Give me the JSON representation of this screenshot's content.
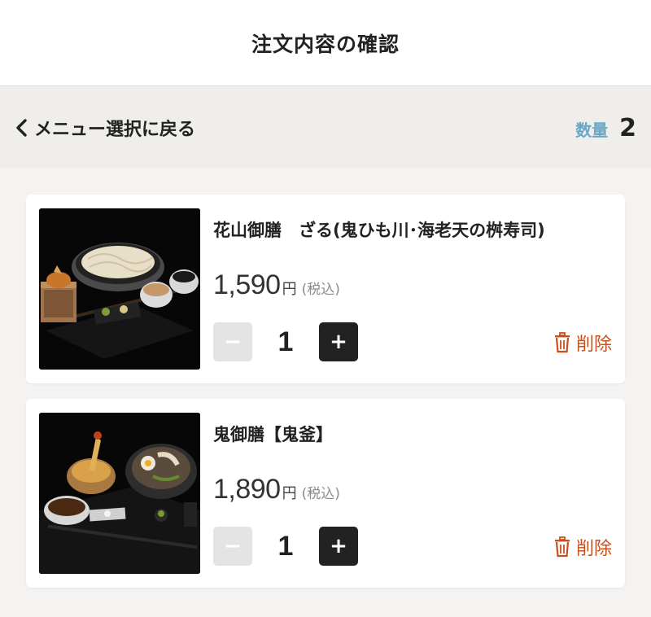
{
  "header": {
    "title": "注文内容の確認"
  },
  "subbar": {
    "back_label": "メニュー選択に戻る",
    "qty_label": "数量",
    "qty_value": "2"
  },
  "items": [
    {
      "name": "花山御膳　ざる(鬼ひも川･海老天の桝寿司)",
      "price": "1,590",
      "unit": "円",
      "tax": "(税込)",
      "quantity": "1",
      "minus": "−",
      "plus": "+",
      "delete_label": "削除",
      "image_icon": "zaru-udon-set-photo"
    },
    {
      "name": "鬼御膳【鬼釜】",
      "price": "1,890",
      "unit": "円",
      "tax": "(税込)",
      "quantity": "1",
      "minus": "−",
      "plus": "+",
      "delete_label": "削除",
      "image_icon": "kama-udon-set-photo"
    }
  ],
  "colors": {
    "accent_blue": "#6aa6c8",
    "delete_orange": "#c8501c",
    "plus_button": "#222222",
    "minus_button_disabled": "#e4e4e4"
  }
}
